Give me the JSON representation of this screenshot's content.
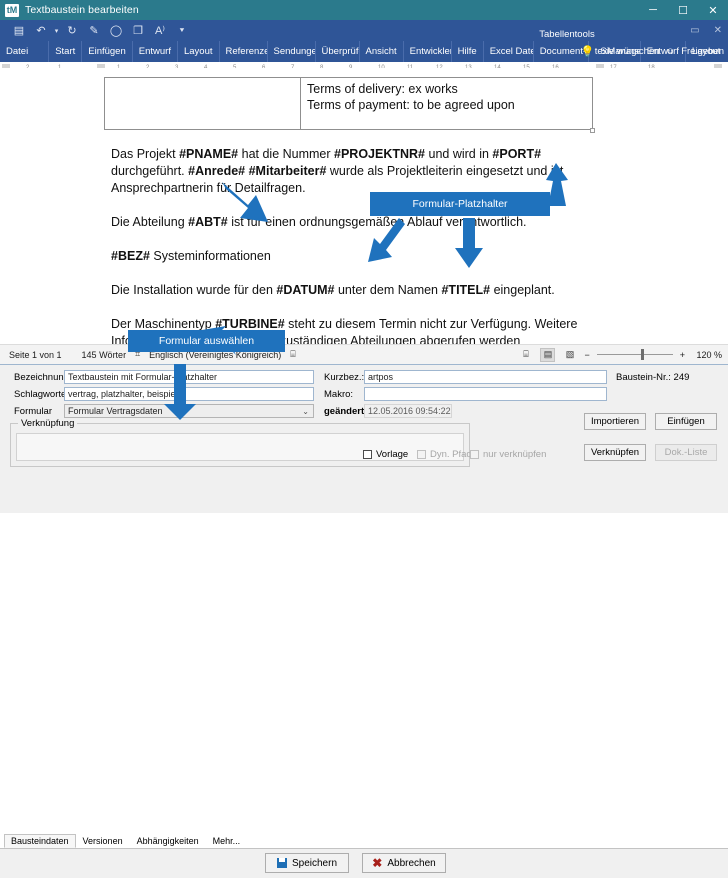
{
  "window": {
    "title": "Textbaustein bearbeiten",
    "logo": "tM",
    "controls": [
      {
        "name": "minimize",
        "glyph": "─"
      },
      {
        "name": "maximize",
        "glyph": "☐"
      },
      {
        "name": "close",
        "glyph": "✕"
      }
    ]
  },
  "quick_access": {
    "icons": [
      {
        "name": "save-icon",
        "glyph": "▤"
      },
      {
        "name": "undo-icon",
        "glyph": "↶"
      },
      {
        "name": "undo-dropdown-icon",
        "glyph": "▾"
      },
      {
        "name": "redo-icon",
        "glyph": "↻"
      },
      {
        "name": "format-painter-icon",
        "glyph": "✎"
      },
      {
        "name": "circle-icon",
        "glyph": "◯"
      },
      {
        "name": "new-document-icon",
        "glyph": "❐"
      },
      {
        "name": "read-aloud-icon",
        "glyph": "A⁾"
      },
      {
        "name": "customize-qat-icon",
        "glyph": "⯆"
      }
    ],
    "contextual_group": "Tabellentools",
    "right_icons": [
      {
        "name": "ribbon-display-options-icon",
        "glyph": "▭"
      },
      {
        "name": "close-ribbon-icon",
        "glyph": "✕"
      }
    ]
  },
  "ribbon": {
    "tabs": [
      "Datei",
      "Start",
      "Einfügen",
      "Entwurf",
      "Layout",
      "Referenzen",
      "Sendungen",
      "Überprüfen",
      "Ansicht",
      "Entwicklertools",
      "Hilfe",
      "Excel Daten",
      "Document-",
      "texManage",
      "Entwurf",
      "Layout"
    ],
    "tell_me": "Sie wünschen",
    "tell_me_icon": "💡",
    "share": "Freigeben",
    "share_icon": "☺"
  },
  "ruler": {
    "marks": [
      "2",
      "1",
      "1",
      "2",
      "3",
      "4",
      "5",
      "6",
      "7",
      "8",
      "9",
      "10",
      "11",
      "12",
      "13",
      "14",
      "15",
      "16",
      "17",
      "18"
    ]
  },
  "document": {
    "table": {
      "left_cell": "",
      "right_cell_lines": [
        "Terms of delivery: ex works",
        "Terms of payment: to be agreed upon"
      ]
    },
    "paragraphs": [
      "Das Projekt #PNAME# hat die Nummer #PROJEKTNR# und wird in #PORT# durchgeführt. #Anrede# #Mitarbeiter# wurde als Projektleiterin eingesetzt und ist Ansprechpartnerin für Detailfragen.",
      "Die Abteilung #ABT# ist für einen ordnungsgemäßen Ablauf verantwortlich.",
      "#BEZ# Systeminformationen",
      "Die Installation wurde für den #DATUM# unter dem Namen #TITEL# eingeplant.",
      "Der Maschinentyp #TURBINE# steht zu diesem Termin nicht zur Verfügung. Weitere Informationen können bei den zuständigen Abteilungen abgerufen werden"
    ]
  },
  "statusbar": {
    "page": "Seite 1 von 1",
    "words": "145 Wörter",
    "proofing_icon": "⌗",
    "language": "Englisch (Vereinigtes Königreich)",
    "accessibility_icon": "⌸",
    "views": [
      {
        "name": "read-mode-icon",
        "glyph": "⌸",
        "active": false
      },
      {
        "name": "print-layout-icon",
        "glyph": "▤",
        "active": true
      },
      {
        "name": "web-layout-icon",
        "glyph": "▧",
        "active": false
      }
    ],
    "zoom_minus": "−",
    "zoom_plus": "+",
    "zoom_value": "120 %"
  },
  "dialog": {
    "fields": {
      "bezeichnung_label": "Bezeichnung:",
      "bezeichnung_value": "Textbaustein mit Formular-Platzhalter",
      "schlagworte_label": "Schlagworte:",
      "schlagworte_value": "vertrag, platzhalter, beispiel",
      "formular_label": "Formular",
      "formular_value": "Formular  Vertragsdaten",
      "formular_arrow": "⌄",
      "kurzbez_label": "Kurzbez.:",
      "kurzbez_value": "artpos",
      "makro_label": "Makro:",
      "makro_value": "",
      "geaendert_label": "geändert:",
      "geaendert_value": "12.05.2016 09:54:22",
      "baustein_nr": "Baustein-Nr.: 249"
    },
    "group": {
      "title": "Verknüpfung",
      "value": ""
    },
    "checkboxes": [
      {
        "label": "Vorlage",
        "checked": false,
        "disabled": false
      },
      {
        "label": "Dyn. Pfad",
        "checked": false,
        "disabled": true
      },
      {
        "label": "nur verknüpfen",
        "checked": false,
        "disabled": true
      }
    ],
    "buttons": {
      "importieren": "Importieren",
      "einfuegen": "Einfügen",
      "verknuepfen": "Verknüpfen",
      "dok_liste": "Dok.-Liste"
    },
    "tabs": [
      {
        "label": "Bausteindaten",
        "active": true
      },
      {
        "label": "Versionen",
        "active": false
      },
      {
        "label": "Abhängigkeiten",
        "active": false
      },
      {
        "label": "Mehr...",
        "active": false
      }
    ],
    "footer": {
      "speichern": "Speichern",
      "abbrechen": "Abbrechen"
    }
  },
  "annotations": {
    "callout1": "Formular-Platzhalter",
    "callout2": "Formular auswählen",
    "color": "#1f72bd"
  }
}
